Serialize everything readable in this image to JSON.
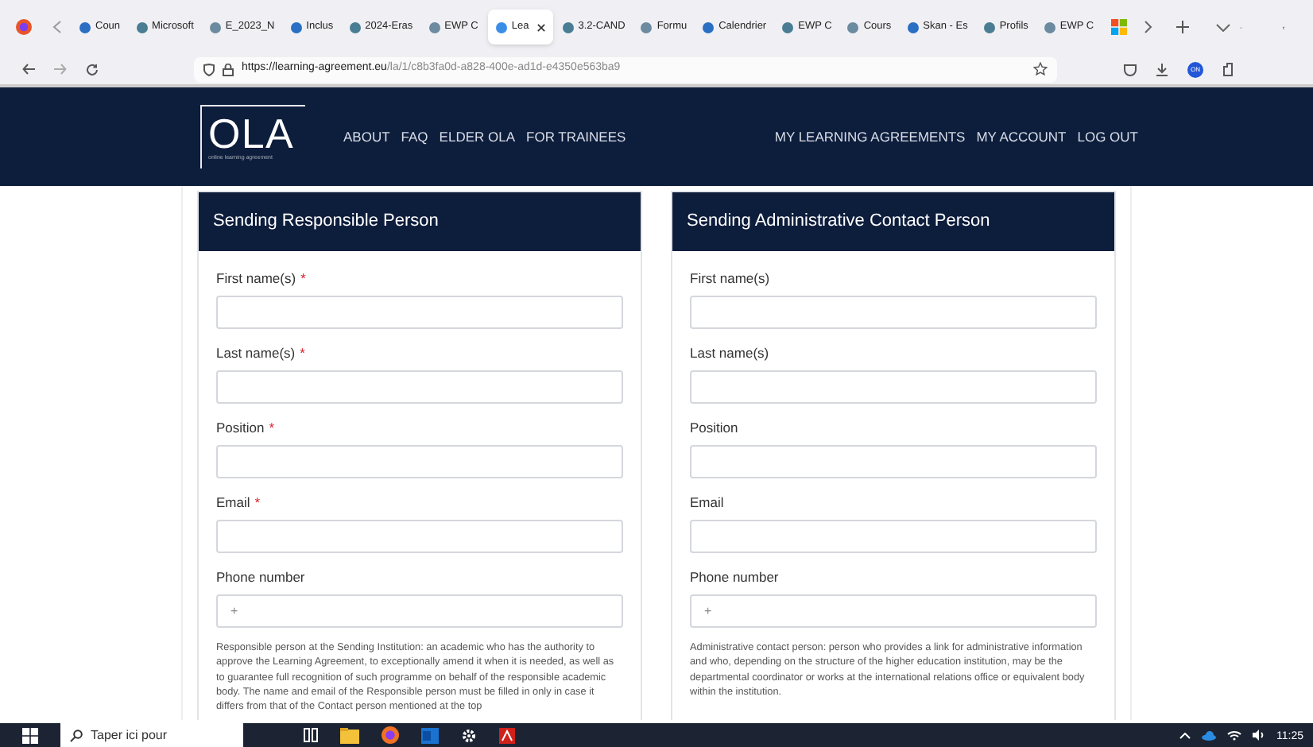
{
  "browser": {
    "tabs": [
      {
        "label": "Coun",
        "selected": false
      },
      {
        "label": "Microsoft",
        "selected": false
      },
      {
        "label": "E_2023_N",
        "selected": false
      },
      {
        "label": "Inclus",
        "selected": false
      },
      {
        "label": "2024-Eras",
        "selected": false
      },
      {
        "label": "EWP C",
        "selected": false
      },
      {
        "label": "Lea",
        "selected": true
      },
      {
        "label": "3.2-CAND",
        "selected": false
      },
      {
        "label": "Formu",
        "selected": false
      },
      {
        "label": "Calendrier",
        "selected": false
      },
      {
        "label": "EWP C",
        "selected": false
      },
      {
        "label": "Cours",
        "selected": false
      },
      {
        "label": "Skan - Es",
        "selected": false
      },
      {
        "label": "Profils",
        "selected": false
      },
      {
        "label": "EWP C",
        "selected": false
      }
    ],
    "url_host": "https://learning-agreement.eu",
    "url_path": "/la/1/c8b3fa0d-a828-400e-ad1d-e4350e563ba9",
    "extension_badge": "ON"
  },
  "nav": {
    "logo": "OLA",
    "logo_tagline": "online learning agreement",
    "left": [
      "ABOUT",
      "FAQ",
      "ELDER OLA",
      "FOR TRAINEES"
    ],
    "right": [
      "MY LEARNING AGREEMENTS",
      "MY ACCOUNT",
      "LOG OUT"
    ]
  },
  "panels": [
    {
      "title": "Sending Responsible Person",
      "fields": [
        {
          "label": "First name(s)",
          "required": true
        },
        {
          "label": "Last name(s)",
          "required": true
        },
        {
          "label": "Position",
          "required": true
        },
        {
          "label": "Email",
          "required": true
        },
        {
          "label": "Phone number",
          "required": false,
          "placeholder": "+"
        }
      ],
      "note": "Responsible person at the Sending Institution: an academic who has the authority to approve the Learning Agreement, to exceptionally amend it when it is needed, as well as to guarantee full recognition of such programme on behalf of the responsible academic body. The name and email of the Responsible person must be filled in only in case it differs from that of the Contact person mentioned at the top"
    },
    {
      "title": "Sending Administrative Contact Person",
      "fields": [
        {
          "label": "First name(s)",
          "required": false
        },
        {
          "label": "Last name(s)",
          "required": false
        },
        {
          "label": "Position",
          "required": false
        },
        {
          "label": "Email",
          "required": false
        },
        {
          "label": "Phone number",
          "required": false,
          "placeholder": "+"
        }
      ],
      "note": "Administrative contact person: person who provides a link for administrative information and who, depending on the structure of the higher education institution, may be the departmental coordinator or works at the international relations office or equivalent body within the institution."
    }
  ],
  "required_marker": "*",
  "taskbar": {
    "search_placeholder": "Taper ici pour",
    "time": "11:25"
  }
}
